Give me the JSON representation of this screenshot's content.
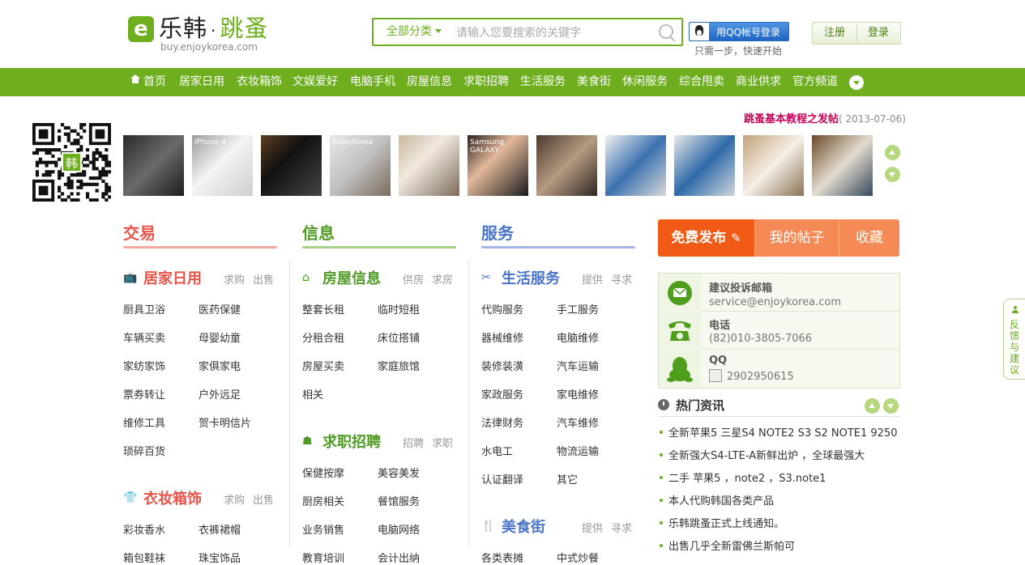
{
  "header": {
    "logo_glyph": "e",
    "logo_name": "乐韩",
    "logo_dot": "·",
    "logo_sub": "跳蚤",
    "logo_url": "buy.enjoykorea.com",
    "search": {
      "category": "全部分类",
      "placeholder": "请输入您要搜索的关键字"
    },
    "qq_login": "用QQ帐号登录",
    "qq_sub": "只需一步，快速开始",
    "register": "注册",
    "login": "登录"
  },
  "nav": {
    "items": [
      "首页",
      "居家日用",
      "衣妆箱饰",
      "文娱爱好",
      "电脑手机",
      "房屋信息",
      "求职招聘",
      "生活服务",
      "美食街",
      "休闲服务",
      "综合甩卖",
      "商业供求",
      "官方频道"
    ]
  },
  "banner": {
    "qr_text": "韩",
    "tutorial_title": "跳蚤基本教程之发帖",
    "tutorial_date": "( 2013-07-06)",
    "thumb_texts": [
      "",
      "iPhone 4",
      "",
      "EnjoyKorea",
      "",
      "Samsung GALAXY",
      "",
      "",
      "",
      "",
      "",
      "",
      ""
    ]
  },
  "columns": [
    {
      "title": "交易",
      "color": "#e8534a",
      "line": "#f2a7a0",
      "cats": [
        {
          "name": "居家日用",
          "icon": "tv-icon",
          "acts": [
            "求购",
            "出售"
          ],
          "links": [
            "厨具卫浴",
            "医药保健",
            "车辆买卖",
            "母婴幼童",
            "家纺家饰",
            "家俱家电",
            "票券转让",
            "户外远足",
            "维修工具",
            "贺卡明信片",
            "琐碎百货"
          ]
        },
        {
          "name": "衣妆箱饰",
          "icon": "tshirt-icon",
          "acts": [
            "求购",
            "出售"
          ],
          "links": [
            "彩妆香水",
            "衣裤裙帽",
            "箱包鞋袜",
            "珠宝饰品"
          ]
        }
      ]
    },
    {
      "title": "信息",
      "color": "#4e9a24",
      "line": "#a5d28b",
      "cats": [
        {
          "name": "房屋信息",
          "icon": "house-icon",
          "acts": [
            "供房",
            "求房"
          ],
          "links": [
            "整套长租",
            "临时短租",
            "分租合租",
            "床位搭铺",
            "房屋买卖",
            "家庭旅馆",
            "相关"
          ]
        },
        {
          "name": "求职招聘",
          "icon": "people-icon",
          "acts": [
            "招聘",
            "求职"
          ],
          "links": [
            "保健按摩",
            "美容美发",
            "厨房相关",
            "餐馆服务",
            "业务销售",
            "电脑网络",
            "教育培训",
            "会计出纳"
          ]
        }
      ]
    },
    {
      "title": "服务",
      "color": "#4a74c8",
      "line": "#a4b6e6",
      "cats": [
        {
          "name": "生活服务",
          "icon": "tools-icon",
          "acts": [
            "提供",
            "寻求"
          ],
          "links": [
            "代购服务",
            "手工服务",
            "器械维修",
            "电脑维修",
            "装修装潢",
            "汽车运输",
            "家政服务",
            "家电维修",
            "法律财务",
            "汽车维修",
            "水电工",
            "物流运输",
            "认证翻译",
            "其它"
          ]
        },
        {
          "name": "美食街",
          "icon": "cutlery-icon",
          "acts": [
            "提供",
            "寻求"
          ],
          "links": [
            "各类表摊",
            "中式炒餐"
          ]
        }
      ]
    }
  ],
  "publish": {
    "free": "免费发布",
    "mine": "我的帖子",
    "fav": "收藏"
  },
  "contact": [
    {
      "label": "建议投诉邮箱",
      "value": "service@enjoykorea.com",
      "icon": "mail-icon"
    },
    {
      "label": "电话",
      "value": "(82)010-3805-7066",
      "icon": "phone-icon"
    },
    {
      "label": "QQ",
      "value": "2902950615",
      "icon": "qq-icon"
    }
  ],
  "hot": {
    "title": "热门资讯",
    "items": [
      "全新苹果5 三星S4 NOTE2 S3 S2 NOTE1 9250",
      "全新强大S4-LTE-A新鲜出炉 ，全球最强大",
      "二手 苹果5 ，note2 ，S3.note1",
      "本人代购韩国各类产品",
      "乐韩跳蚤正式上线通知。",
      "出售几乎全新雷佛兰斯帕可"
    ]
  },
  "feedback": "反馈与建议",
  "colors": {
    "brand": "#6fae1f",
    "publish_dark": "#f05a14",
    "publish_light": "#f68a57"
  }
}
